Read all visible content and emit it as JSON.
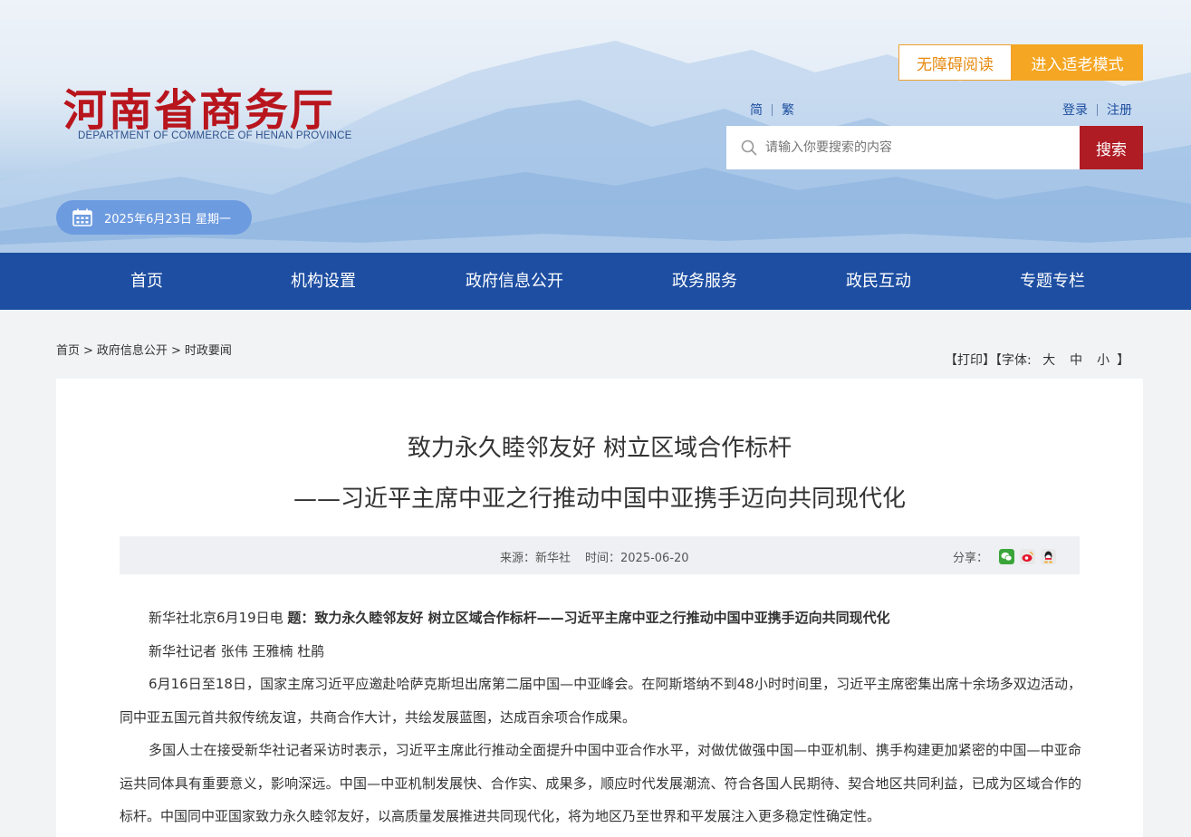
{
  "header": {
    "logo_cn": "河南省商务厅",
    "logo_en": "DEPARTMENT OF COMMERCE OF HENAN PROVINCE",
    "accessibility_label": "无障碍阅读",
    "elder_mode_label": "进入适老模式",
    "lang_simplified": "简",
    "lang_traditional": "繁",
    "login_label": "登录",
    "register_label": "注册",
    "search_placeholder": "请输入你要搜索的内容",
    "search_button": "搜索",
    "date": "2025年6月23日 星期一"
  },
  "nav": {
    "items": [
      "首页",
      "机构设置",
      "政府信息公开",
      "政务服务",
      "政民互动",
      "专题专栏"
    ]
  },
  "breadcrumb": {
    "items": [
      "首页",
      "政府信息公开",
      "时政要闻"
    ],
    "separator": ">"
  },
  "tools": {
    "print": "【打印】",
    "font_label": "【字体:",
    "large": "大",
    "medium": "中",
    "small": "小",
    "close": "】"
  },
  "article": {
    "title": "致力永久睦邻友好 树立区域合作标杆",
    "subtitle": "——习近平主席中亚之行推动中国中亚携手迈向共同现代化",
    "source": "来源：新华社",
    "time": "时间：2025-06-20",
    "share_label": "分享：",
    "para1_prefix": "新华社北京6月19日电  ",
    "para1_bold": "题：致力永久睦邻友好  树立区域合作标杆——习近平主席中亚之行推动中国中亚携手迈向共同现代化",
    "para2": "新华社记者 张伟  王雅楠  杜鹃",
    "para3": "6月16日至18日，国家主席习近平应邀赴哈萨克斯坦出席第二届中国—中亚峰会。在阿斯塔纳不到48小时时间里，习近平主席密集出席十余场多双边活动，同中亚五国元首共叙传统友谊，共商合作大计，共绘发展蓝图，达成百余项合作成果。",
    "para4": "多国人士在接受新华社记者采访时表示，习近平主席此行推动全面提升中国中亚合作水平，对做优做强中国—中亚机制、携手构建更加紧密的中国—中亚命运共同体具有重要意义，影响深远。中国—中亚机制发展快、合作实、成果多，顺应时代发展潮流、符合各国人民期待、契合地区共同利益，已成为区域合作的标杆。中国同中亚国家致力永久睦邻友好，以高质量发展推进共同现代化，将为地区乃至世界和平发展注入更多稳定性确定性。"
  },
  "colors": {
    "brand_red": "#b01c24",
    "nav_blue": "#1d4ea2",
    "accent_orange": "#f5a623"
  }
}
